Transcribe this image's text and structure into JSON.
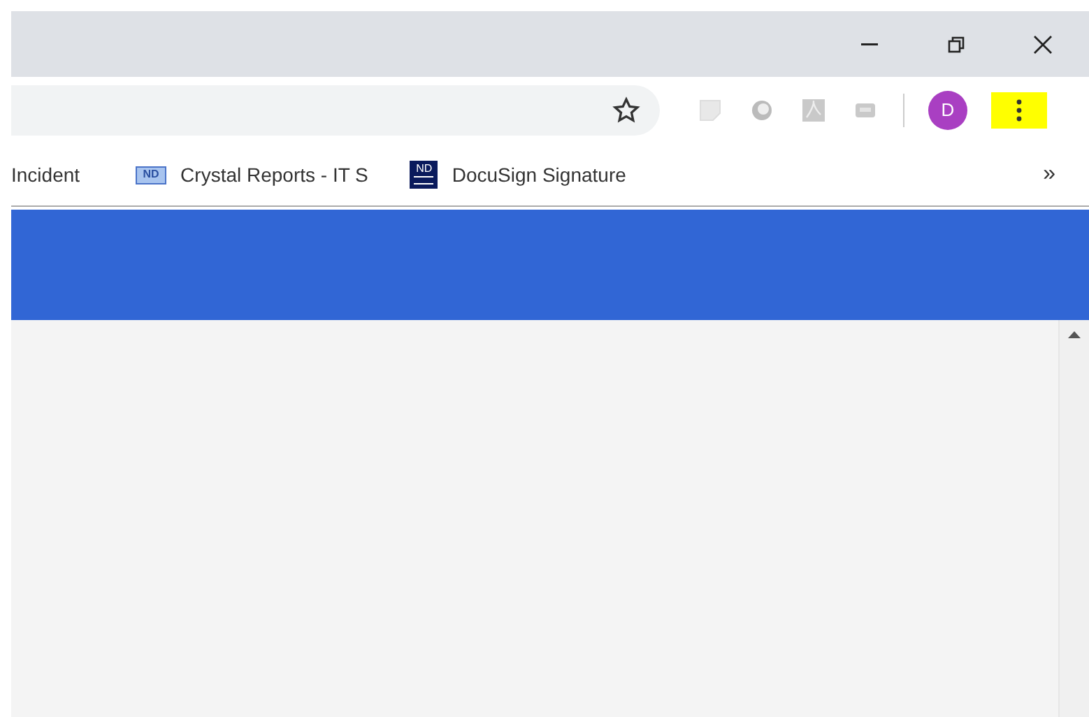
{
  "window": {
    "buttons": [
      {
        "kind": "minimize"
      },
      {
        "kind": "restore"
      },
      {
        "kind": "close"
      }
    ]
  },
  "toolbar": {
    "avatar": "D",
    "menu_highlighted": true
  },
  "bookmarks": [
    {
      "label": "Incident"
    },
    {
      "label": "Crystal Reports - IT S",
      "favicon": "ND",
      "kind": "badge"
    },
    {
      "label": "DocuSign Signature",
      "favicon": "ND",
      "kind": "dark"
    }
  ],
  "bookmarks_overflow": "»"
}
